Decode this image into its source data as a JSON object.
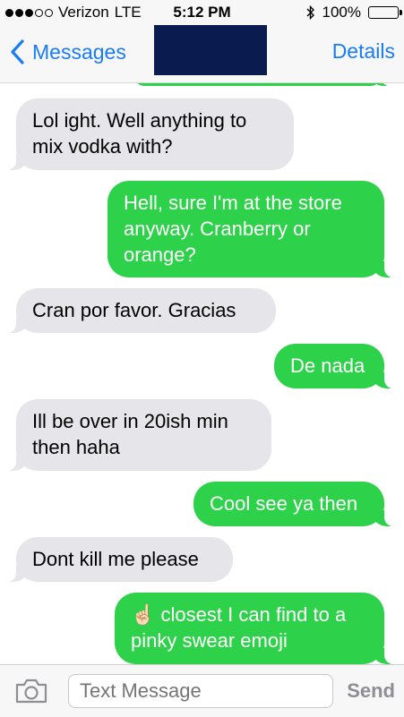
{
  "status": {
    "carrier": "Verizon",
    "network": "LTE",
    "time": "5:12 PM",
    "battery": "100%",
    "battery_level": 1.0
  },
  "nav": {
    "back_label": "Messages",
    "details_label": "Details"
  },
  "messages": [
    {
      "from": "them",
      "text": "Lol ight. Well anything to\nmix vodka with?"
    },
    {
      "from": "me",
      "text": "Hell, sure I'm at the store\nanyway. Cranberry or\norange?"
    },
    {
      "from": "them",
      "text": "Cran por favor. Gracias"
    },
    {
      "from": "me",
      "text": "De nada"
    },
    {
      "from": "them",
      "text": "Ill be over in 20ish min\nthen haha"
    },
    {
      "from": "me",
      "text": "Cool see ya then"
    },
    {
      "from": "them",
      "text": "Dont kill me please"
    },
    {
      "from": "me",
      "text": "☝🏻 closest I can find to a\npinky swear emoji"
    }
  ],
  "composer": {
    "placeholder": "Text Message",
    "send_label": "Send"
  },
  "colors": {
    "accent": "#1a7cf5",
    "outgoing_bubble": "#2ed14a",
    "incoming_bubble": "#e5e5ea"
  }
}
